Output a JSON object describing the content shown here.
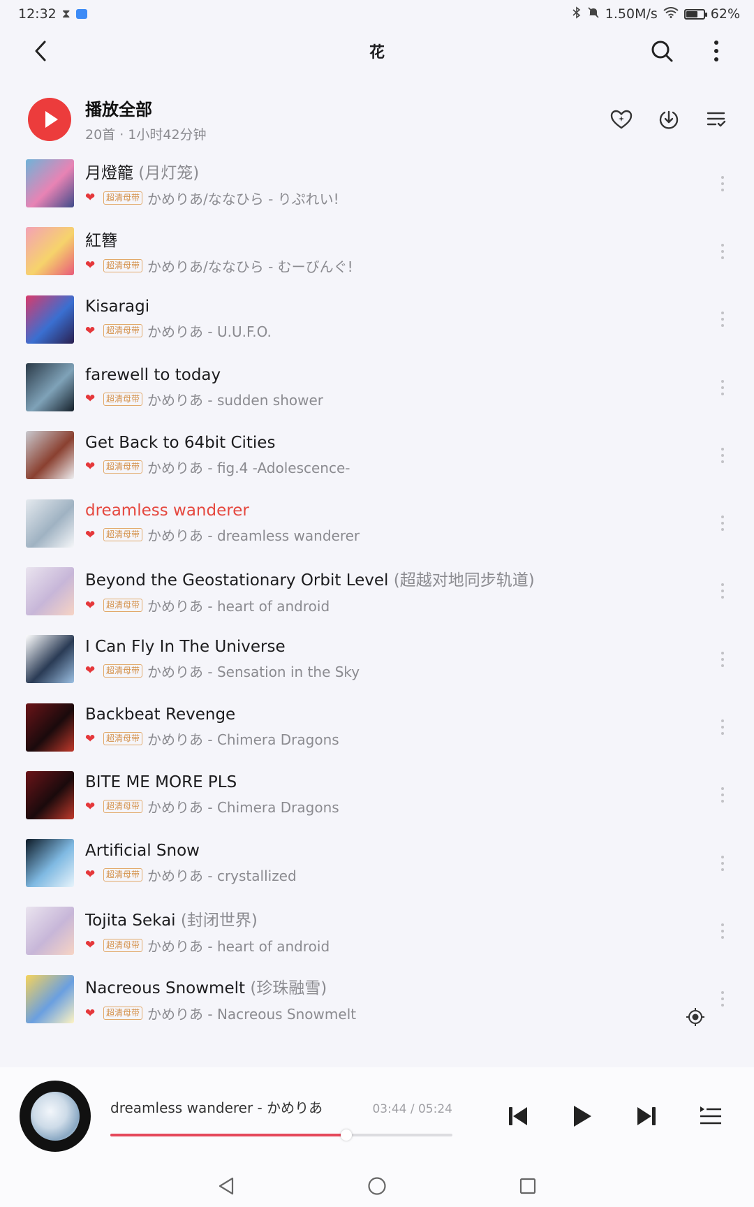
{
  "status_bar": {
    "time": "12:32",
    "icons_left": [
      "hourglass-icon",
      "cloud-icon"
    ],
    "net_speed": "1.50M/s",
    "battery": "62%",
    "battery_level": 0.62,
    "icons_right": [
      "bluetooth-icon",
      "mute-icon",
      "wifi-icon",
      "battery-icon"
    ]
  },
  "header": {
    "title": "花",
    "icons": [
      "back-icon",
      "search-icon",
      "more-vertical-icon"
    ]
  },
  "play_all": {
    "label": "播放全部",
    "summary": "20首 · 1小时42分钟",
    "actions": [
      "favorite-heart-icon",
      "download-icon",
      "multi-select-icon"
    ]
  },
  "colors": {
    "accent": "#ec3c3c",
    "playing_title": "#e5483f",
    "badge": "#d4914a",
    "progress": "#e5485b"
  },
  "badge_label": "超清母带",
  "songs": [
    {
      "title": "月燈籠",
      "alias": " (月灯笼)",
      "artist_album": "かめりあ/ななひら - りぷれい!",
      "playing": false,
      "cover": [
        "#6fb3d8",
        "#e883b4",
        "#3f4b8a"
      ]
    },
    {
      "title": "紅簪",
      "alias": "",
      "artist_album": "かめりあ/ななひら - むーびんぐ!",
      "playing": false,
      "cover": [
        "#f3a1b6",
        "#f6d36b",
        "#e85a7a"
      ]
    },
    {
      "title": "Kisaragi",
      "alias": "",
      "artist_album": "かめりあ - U.U.F.O.",
      "playing": false,
      "cover": [
        "#d93a6b",
        "#3a6fd1",
        "#2a1f4f"
      ]
    },
    {
      "title": "farewell to today",
      "alias": "",
      "artist_album": "かめりあ - sudden shower",
      "playing": false,
      "cover": [
        "#2b3a48",
        "#7fa2b8",
        "#15202a"
      ]
    },
    {
      "title": "Get Back to 64bit Cities",
      "alias": "",
      "artist_album": "かめりあ - fig.4 -Adolescence-",
      "playing": false,
      "cover": [
        "#c9c9cf",
        "#8a4030",
        "#efeff2"
      ]
    },
    {
      "title": "dreamless wanderer",
      "alias": "",
      "artist_album": "かめりあ - dreamless wanderer",
      "playing": true,
      "cover": [
        "#e4e9ee",
        "#9fb2c2",
        "#f6f7f9"
      ]
    },
    {
      "title": "Beyond the Geostationary Orbit Level",
      "alias": " (超越对地同步轨道)",
      "artist_album": "かめりあ - heart of android",
      "playing": false,
      "cover": [
        "#eae4ef",
        "#c7b6d8",
        "#f7d4c4"
      ]
    },
    {
      "title": "I Can Fly In The Universe",
      "alias": "",
      "artist_album": "かめりあ - Sensation in the Sky",
      "playing": false,
      "cover": [
        "#ffffff",
        "#2a3b55",
        "#9cc0e3"
      ]
    },
    {
      "title": "Backbeat Revenge",
      "alias": "",
      "artist_album": "かめりあ - Chimera Dragons",
      "playing": false,
      "cover": [
        "#6b1418",
        "#1a0a0c",
        "#c0392b"
      ]
    },
    {
      "title": "BITE ME MORE PLS",
      "alias": "",
      "artist_album": "かめりあ - Chimera Dragons",
      "playing": false,
      "cover": [
        "#6b1418",
        "#1a0a0c",
        "#c0392b"
      ]
    },
    {
      "title": "Artificial Snow",
      "alias": "",
      "artist_album": "かめりあ - crystallized",
      "playing": false,
      "cover": [
        "#0d1a26",
        "#7fb9e2",
        "#e8f4fb"
      ]
    },
    {
      "title": "Tojita Sekai",
      "alias": " (封闭世界)",
      "artist_album": "かめりあ - heart of android",
      "playing": false,
      "cover": [
        "#eae4ef",
        "#c7b6d8",
        "#f7d4c4"
      ]
    },
    {
      "title": "Nacreous Snowmelt",
      "alias": " (珍珠融雪)",
      "artist_album": "かめりあ - Nacreous Snowmelt",
      "playing": false,
      "cover": [
        "#f6d35b",
        "#6a9fe0",
        "#fff4c2"
      ]
    }
  ],
  "player": {
    "track": "dreamless wanderer - かめりあ",
    "time": "03:44 / 05:24",
    "progress": 0.69,
    "controls": [
      "previous-icon",
      "play-icon",
      "next-icon",
      "playlist-icon"
    ]
  },
  "nav": [
    "back-triangle-icon",
    "home-circle-icon",
    "recents-square-icon"
  ]
}
